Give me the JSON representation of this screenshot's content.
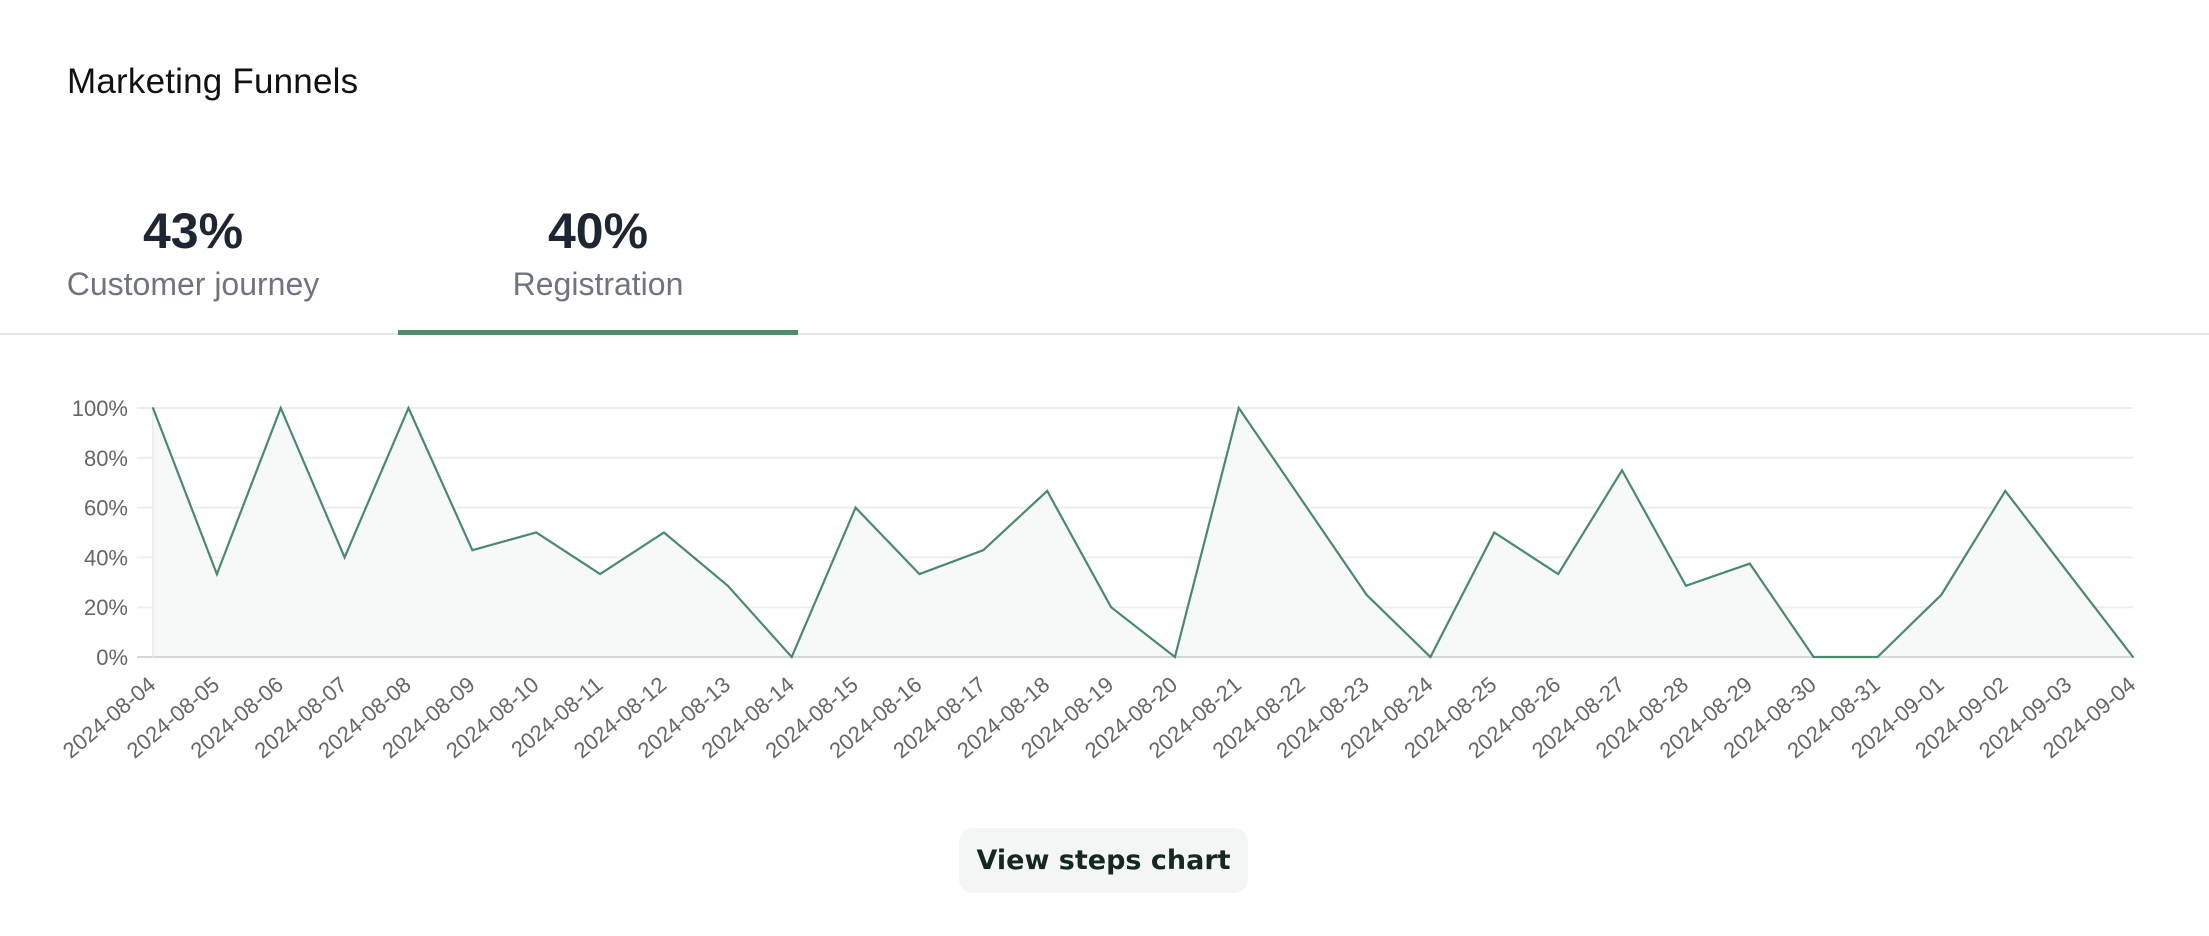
{
  "header": {
    "title": "Marketing Funnels"
  },
  "tabs": [
    {
      "value": "43%",
      "label": "Customer journey",
      "active": false
    },
    {
      "value": "40%",
      "label": "Registration",
      "active": true
    }
  ],
  "colors": {
    "accent": "#4f8a6c",
    "line": "#4a8a6c",
    "fill": "#f6f9f7",
    "grid": "#ededed",
    "axis": "#d6d6d6"
  },
  "actions": {
    "view_steps_label": "View steps chart"
  },
  "chart_data": {
    "type": "area",
    "title": "",
    "xlabel": "",
    "ylabel": "",
    "ylim": [
      0,
      100
    ],
    "yticks": [
      "0%",
      "20%",
      "40%",
      "60%",
      "80%",
      "100%"
    ],
    "ytick_values": [
      0,
      20,
      40,
      60,
      80,
      100
    ],
    "grid": true,
    "legend": "none",
    "x": [
      "2024-08-04",
      "2024-08-05",
      "2024-08-06",
      "2024-08-07",
      "2024-08-08",
      "2024-08-09",
      "2024-08-10",
      "2024-08-11",
      "2024-08-12",
      "2024-08-13",
      "2024-08-14",
      "2024-08-15",
      "2024-08-16",
      "2024-08-17",
      "2024-08-18",
      "2024-08-19",
      "2024-08-20",
      "2024-08-21",
      "2024-08-22",
      "2024-08-23",
      "2024-08-24",
      "2024-08-25",
      "2024-08-26",
      "2024-08-27",
      "2024-08-28",
      "2024-08-29",
      "2024-08-30",
      "2024-08-31",
      "2024-09-01",
      "2024-09-02",
      "2024-09-03",
      "2024-09-04"
    ],
    "series": [
      {
        "name": "Registration",
        "values": [
          100,
          33.3,
          100,
          40,
          100,
          42.9,
          50,
          33.3,
          50,
          28.6,
          0,
          60,
          33.3,
          42.9,
          66.7,
          20,
          0,
          100,
          62.5,
          25,
          0,
          50,
          33.3,
          75,
          28.6,
          37.5,
          0,
          0,
          25,
          66.7,
          33.3,
          0
        ]
      }
    ]
  }
}
